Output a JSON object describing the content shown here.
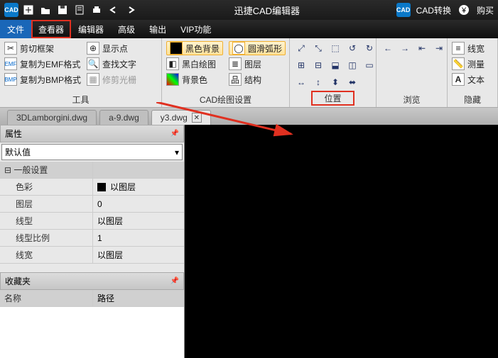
{
  "titlebar": {
    "title": "迅捷CAD编辑器",
    "convert": "CAD转换",
    "buy": "购买"
  },
  "menu": {
    "file": "文件",
    "viewer": "查看器",
    "editor": "编辑器",
    "advanced": "高级",
    "output": "输出",
    "vip": "VIP功能"
  },
  "ribbon": {
    "tools": {
      "label": "工具",
      "clip": "剪切框架",
      "emf": "复制为EMF格式",
      "bmp": "复制为BMP格式",
      "showpt": "显示点",
      "findtxt": "查找文字",
      "trimcd": "修剪光栅"
    },
    "cad": {
      "label": "CAD绘图设置",
      "blackbg": "黑色背景",
      "bwdraw": "黑白绘图",
      "bgcolor": "背景色",
      "smootharc": "圆滑弧形",
      "layer": "图层",
      "struct": "结构"
    },
    "position": {
      "label": "位置"
    },
    "browse": {
      "label": "浏览",
      "linew": "线宽",
      "measure": "测量",
      "text": "文本",
      "favorite": "隐藏"
    }
  },
  "tabs": {
    "t1": "3DLamborgini.dwg",
    "t2": "a-9.dwg",
    "t3": "y3.dwg"
  },
  "props": {
    "title": "属性",
    "default": "默认值",
    "general": "一般设置",
    "color_k": "色彩",
    "color_v": "以图层",
    "layer_k": "图层",
    "layer_v": "0",
    "ltype_k": "线型",
    "ltype_v": "以图层",
    "lscale_k": "线型比例",
    "lscale_v": "1",
    "lwidth_k": "线宽",
    "lwidth_v": "以图层"
  },
  "fav": {
    "title": "收藏夹",
    "name": "名称",
    "path": "路径"
  }
}
